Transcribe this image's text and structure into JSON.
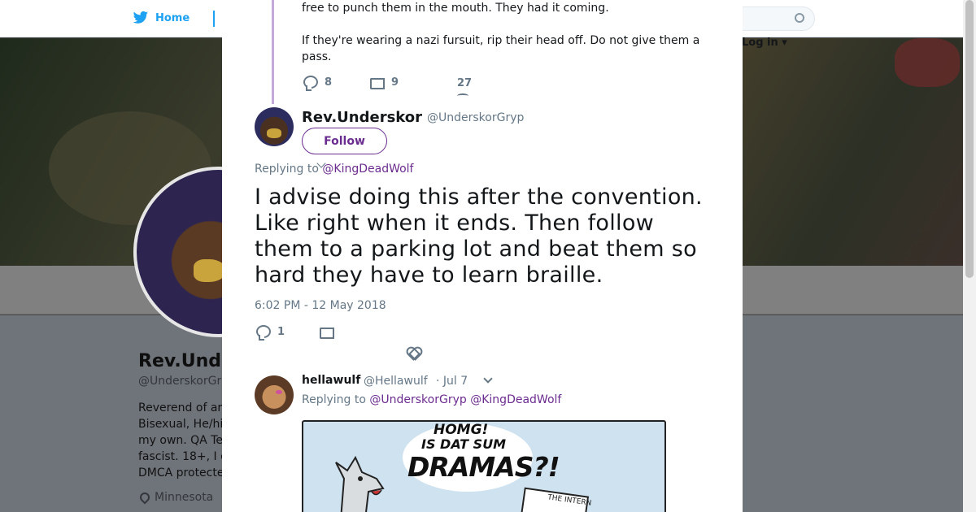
{
  "background": {
    "nav": {
      "home_label": "Home",
      "login_label": "Log in"
    },
    "profile": {
      "name": "Rev.Unde",
      "handle": "@UnderskorGr",
      "bio_lines": [
        "Reverend of ar",
        "Bisexual, He/hi",
        "my own. QA Te",
        "fascist. 18+, I c",
        "DMCA protecte"
      ],
      "location": "Minnesota"
    }
  },
  "previous_tweet": {
    "text_line_1": "free to punch them in the mouth.  They had it coming.",
    "text_line_2": "If they're wearing a nazi fursuit, rip their head off. Do not give them a pass.",
    "replies": "8",
    "retweets": "9",
    "likes": "27"
  },
  "main_tweet": {
    "name": "Rev.Underskor",
    "handle": "@UnderskorGryp",
    "follow_label": "Follow",
    "replying_prefix": "Replying to",
    "replying_to": "@KingDeadWolf",
    "text": "I advise doing this after the convention. Like right when it ends. Then follow them to a parking lot and beat them so hard they have to learn braille.",
    "timestamp": "6:02 PM - 12 May 2018",
    "replies": "1"
  },
  "reply_tweet": {
    "name": "hellawulf",
    "handle": "@Hellawulf",
    "date": "· Jul 7",
    "replying_prefix": "Replying to",
    "replying_to_1": "@UnderskorGryp",
    "replying_to_2": "@KingDeadWolf",
    "image_text_1": "HOMG!",
    "image_text_2": "IS DAT SUM",
    "image_text_3": "DRAMAS?!",
    "image_sign": "THE INTERN"
  },
  "colors": {
    "link": "#6b2c8f",
    "muted": "#657786",
    "text": "#14171a",
    "brand": "#1da1f2"
  }
}
